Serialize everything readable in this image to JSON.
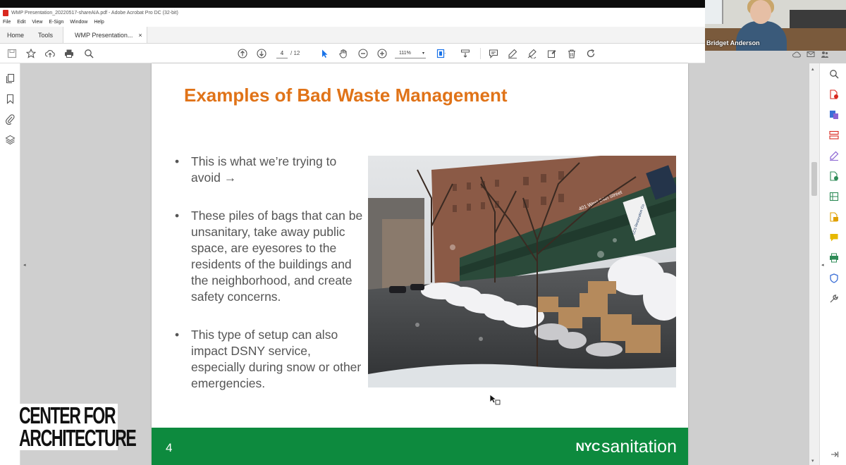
{
  "window": {
    "title": "WMP Presentation_20220517-shareAIA.pdf - Adobe Acrobat Pro DC (32-bit)"
  },
  "menu": [
    "File",
    "Edit",
    "View",
    "E-Sign",
    "Window",
    "Help"
  ],
  "tabs": {
    "home": "Home",
    "tools": "Tools",
    "document": "WMP Presentation...",
    "close": "×"
  },
  "toolbar": {
    "page_current": "4",
    "page_total": "/ 12",
    "zoom": "111%"
  },
  "video": {
    "participant_name": "Bridget Anderson"
  },
  "slide": {
    "title": "Examples of Bad Waste Management",
    "bullets": [
      "This is what we’re trying to avoid →",
      "These piles of bags that can be unsanitary, take away public space, are eyesores to the residents of the buildings and the neighborhood, and create safety concerns.",
      "This type of setup can also impact DSNY service, especially during snow or other emergencies."
    ],
    "bullet_symbol": "•",
    "photo_sign": "401 West 24th Street",
    "photo_sign2": "LCS Restoration Co.",
    "page_number": "4",
    "brand_nyc": "NYC",
    "brand_sanitation": "sanitation",
    "colors": {
      "title": "#e07318",
      "footer": "#0d8a3e",
      "body_text": "#555555"
    }
  },
  "overlay_logo": {
    "line1": "CENTER  FOR",
    "line2": "ARCHITECTURE"
  },
  "icons": {
    "toolbar": [
      "save-icon",
      "bookmark-star-icon",
      "upload-cloud-icon",
      "print-icon",
      "search-zoom-icon",
      "prev-page-icon",
      "next-page-icon",
      "select-cursor-icon",
      "hand-icon",
      "zoom-out-icon",
      "zoom-in-icon",
      "fit-page-icon",
      "scroll-mode-icon",
      "comment-icon",
      "highlight-pen-icon",
      "sign-icon",
      "edit-icon",
      "delete-icon",
      "rotate-icon"
    ],
    "left_rail": [
      "pages-icon",
      "bookmark-icon",
      "attachment-icon",
      "layers-icon"
    ],
    "right_rail": [
      "search-zoom-icon",
      "export-pdf-icon",
      "create-pdf-icon",
      "organize-pages-icon",
      "fill-sign-icon",
      "edit-pdf-icon",
      "compress-icon",
      "export-icon",
      "comment-icon",
      "print-production-icon",
      "protect-icon",
      "more-tools-icon"
    ]
  }
}
